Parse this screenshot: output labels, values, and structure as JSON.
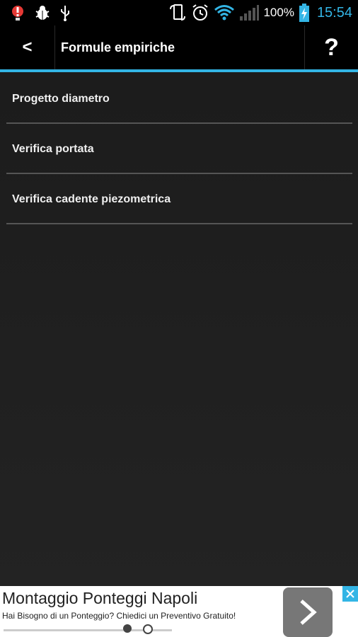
{
  "status_bar": {
    "battery_percent": "100%",
    "time": "15:54",
    "icons": [
      "notification-alert-icon",
      "debug-bug-icon",
      "usb-icon",
      "rotation-lock-icon",
      "alarm-clock-icon",
      "wifi-icon",
      "signal-bars-icon",
      "battery-charging-icon"
    ]
  },
  "action_bar": {
    "back_label": "<",
    "title": "Formule empiriche",
    "help_label": "?"
  },
  "menu": {
    "items": [
      {
        "label": "Progetto diametro"
      },
      {
        "label": "Verifica portata"
      },
      {
        "label": "Verifica cadente piezometrica"
      }
    ]
  },
  "ad": {
    "title": "Montaggio Ponteggi Napoli",
    "subtitle": "Hai Bisogno di un Ponteggio? Chiedici un Preventivo Gratuito!",
    "page_indicator": {
      "current": 1,
      "total": 2
    },
    "icons": [
      "chevron-right-icon",
      "close-icon"
    ]
  },
  "colors": {
    "accent": "#33b5e5",
    "background": "#1c1c1c",
    "ad_background": "#ffffff"
  }
}
